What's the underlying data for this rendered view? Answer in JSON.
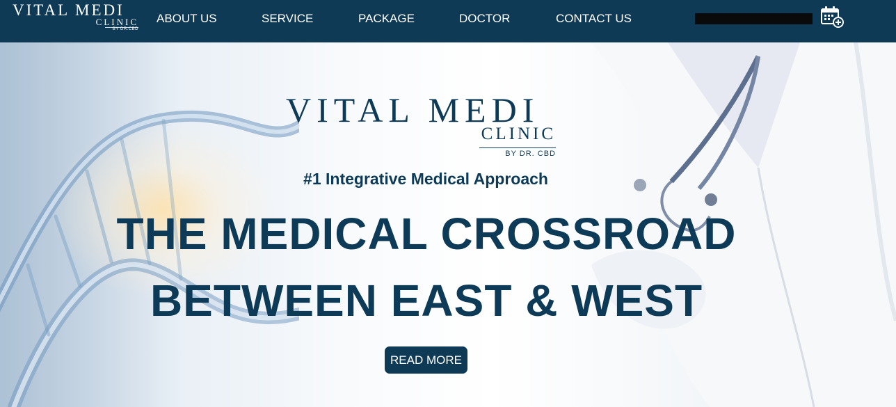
{
  "header": {
    "logo": {
      "line1": "VITAL MEDI",
      "line2": "CLINIC",
      "line3": "BY DR.CBD"
    },
    "nav": [
      "ABOUT US",
      "SERVICE",
      "PACKAGE",
      "DOCTOR",
      "CONTACT US"
    ],
    "calendar_icon": "calendar-add-icon"
  },
  "hero": {
    "logo": {
      "line1": "VITAL MEDI",
      "line2": "CLINIC",
      "line3": "BY DR. CBD"
    },
    "tagline": "#1 Integrative Medical Approach",
    "headline_line1": "THE MEDICAL CROSSROAD",
    "headline_line2": "BETWEEN EAST & WEST",
    "button_label": "READ MORE"
  },
  "colors": {
    "brand": "#0e3a55",
    "heading": "#0d3a57",
    "text_on_brand": "#ffffff"
  }
}
